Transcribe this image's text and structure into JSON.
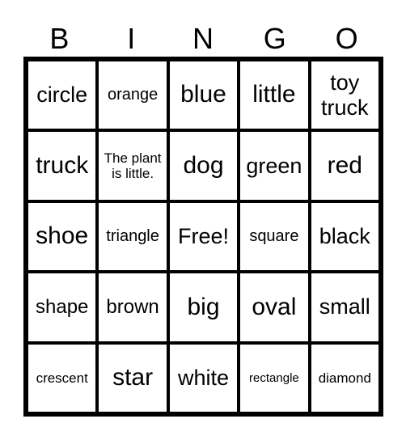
{
  "header": [
    "B",
    "I",
    "N",
    "G",
    "O"
  ],
  "cells": [
    [
      "circle",
      "orange",
      "blue",
      "little",
      "toy truck"
    ],
    [
      "truck",
      "The plant is little.",
      "dog",
      "green",
      "red"
    ],
    [
      "shoe",
      "triangle",
      "Free!",
      "square",
      "black"
    ],
    [
      "shape",
      "brown",
      "big",
      "oval",
      "small"
    ],
    [
      "crescent",
      "star",
      "white",
      "rectangle",
      "diamond"
    ]
  ]
}
